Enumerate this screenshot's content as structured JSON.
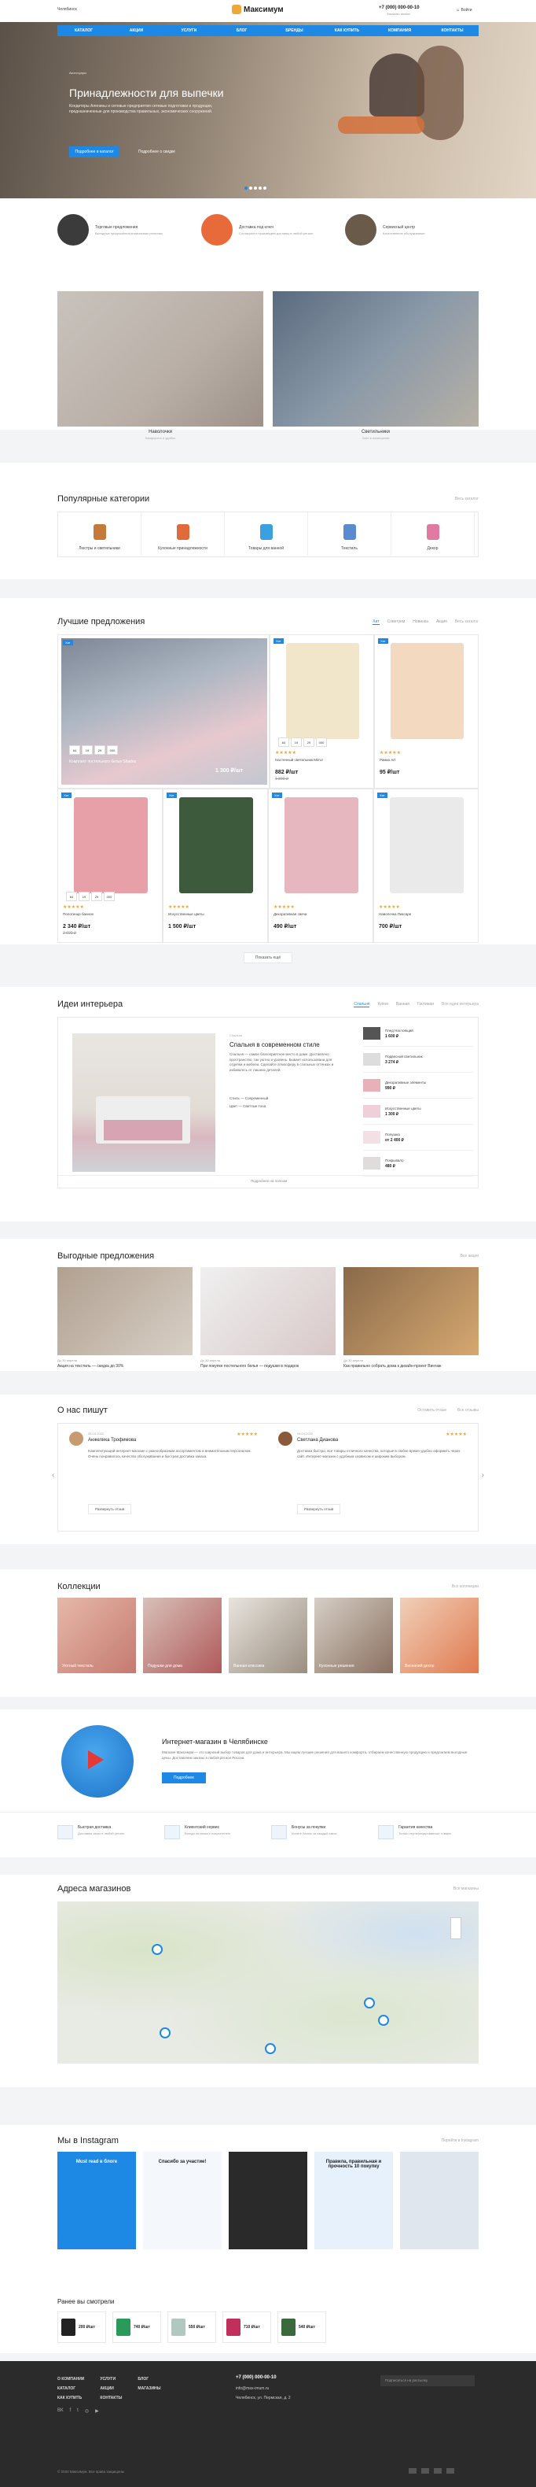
{
  "header": {
    "city": "Челябинск",
    "logo_text": "Максимум",
    "phone": "+7 (000) 000-00-10",
    "phone_note": "Заказать звонок",
    "login": "Войти"
  },
  "nav": [
    "Каталог",
    "Акции",
    "Услуги",
    "Блог",
    "Бренды",
    "Как купить",
    "Компания",
    "Контакты"
  ],
  "hero": {
    "crumb": "Аксессуары",
    "title": "Принадлежности для выпечки",
    "text": "Кондитеры Аленины и сетевые предприятия сетевые подготовки и продукции, предназначенные для производства правильных, экономических сооружений.",
    "btn1": "Подробнее в каталог",
    "btn2": "Подробнее о скидке"
  },
  "features": [
    {
      "title": "Торговые предложения",
      "text": "Выгодные предложения в магазинах регионах"
    },
    {
      "title": "Доставка под ключ",
      "text": "Согласуем и произведем доставку в любой регион"
    },
    {
      "title": "Сервисный центр",
      "text": "Качественное обслуживание"
    }
  ],
  "promo": [
    {
      "title": "Наволочки",
      "sub": "Комфортно и удобно"
    },
    {
      "title": "Светильники",
      "sub": "Свет в помещении"
    }
  ],
  "categories": {
    "title": "Популярные категории",
    "link": "Весь каталог",
    "items": [
      "Люстры и светильники",
      "Кухонные принадлежности",
      "Товары для ванной",
      "Текстиль",
      "Декор"
    ]
  },
  "best": {
    "title": "Лучшие предложения",
    "tabs": [
      "Хит",
      "Советуем",
      "Новинка",
      "Акция"
    ],
    "link": "Весь каталог",
    "big": {
      "name": "Комплект постельного белья Shades",
      "price": "1 300 ₽/шт",
      "timer": [
        "64",
        "19",
        "29",
        "000"
      ]
    },
    "items": [
      {
        "name": "Настенный светильник Mirror",
        "price": "882 ₽/шт",
        "old": "1 300 ₽",
        "timer": [
          "64",
          "19",
          "29",
          "000"
        ],
        "tag": "Хит",
        "tagc": "#1e88e5"
      },
      {
        "name": "Рамка Art",
        "price": "95 ₽/шт",
        "old": "",
        "timer": [],
        "tag": "Хит",
        "tagc": "#1e88e5"
      },
      {
        "name": "Полотенце банное",
        "price": "2 340 ₽/шт",
        "old": "2 600 ₽",
        "timer": [
          "64",
          "19",
          "29",
          "000"
        ],
        "tag": "Хит",
        "tagc": "#1e88e5"
      },
      {
        "name": "Искусственные цветы",
        "price": "1 500 ₽/шт",
        "old": "",
        "timer": [],
        "tag": "Хит",
        "tagc": "#1e88e5"
      },
      {
        "name": "Декоративная свеча",
        "price": "490 ₽/шт",
        "old": "",
        "timer": [],
        "tag": "Хит",
        "tagc": "#1e88e5"
      },
      {
        "name": "Наволочка Пиксаре",
        "price": "700 ₽/шт",
        "old": "",
        "timer": [],
        "tag": "Хит",
        "tagc": "#1e88e5"
      }
    ],
    "more": "Показать ещё"
  },
  "ideas": {
    "title": "Идеи интерьера",
    "tabs": [
      "Спальня",
      "Кухня",
      "Ванная",
      "Гостиная"
    ],
    "link": "Все идеи интерьера",
    "crumb": "Спальня",
    "heading": "Спальня в современном стиле",
    "text": "Спальня — самое благоприятное место в доме. Доставлено пространство, так уютно и уровень. Бывает использована для отделки и мебели. Сделайте атмосферу в стильных оттенках и избавьтесь от лишних деталей.",
    "meta": [
      "Стиль — Современный",
      "Цвет — Светлые тона"
    ],
    "products": [
      {
        "name": "Плед Настоящий",
        "price": "1 600 ₽"
      },
      {
        "name": "Подвесной светильник",
        "price": "3 274 ₽"
      },
      {
        "name": "Декоративные элементы",
        "price": "990 ₽"
      },
      {
        "name": "Искусственные цветы",
        "price": "1 300 ₽"
      },
      {
        "name": "Полушка",
        "price": "от 2 400 ₽"
      },
      {
        "name": "Покрывало",
        "price": "480 ₽"
      }
    ],
    "more": "Подробнее на полном"
  },
  "offers": {
    "title": "Выгодные предложения",
    "link": "Все акции",
    "items": [
      {
        "date": "До 30 апреля",
        "text": "Акция на текстиль — скидка до 30%"
      },
      {
        "date": "До 30 апреля",
        "text": "При покупке постельного белья — подушки в подарок"
      },
      {
        "date": "До 30 апреля",
        "text": "Как правильно собрать дома к дизайн-проект Винтаж"
      }
    ]
  },
  "reviews": {
    "title": "О нас пишут",
    "link1": "Оставить отзыв",
    "link2": "Все отзывы",
    "items": [
      {
        "date": "08.04.2020",
        "name": "Анжелика Трофимова",
        "text": "Комплектующий интернет-магазин с разнообразным ассортиментом и внимательным персоналом. Очень понравилось качество обслуживания и быстрая доставка заказа.",
        "btn": "Развернуть отзыв"
      },
      {
        "date": "08.04.2020",
        "name": "Светлана Дианова",
        "text": "Доставка быстро, все товары отличного качества, которые в любое время удобно оформить через сайт. Интернет-магазин с удобным сервисом и широким выбором.",
        "btn": "Развернуть отзыв"
      }
    ]
  },
  "collections": {
    "title": "Коллекции",
    "link": "Все коллекции",
    "items": [
      "Уютный текстиль",
      "Подушки для дома",
      "Ванная классика",
      "Кухонные решения",
      "Весенний декор"
    ]
  },
  "about": {
    "title": "Интернет-магазин в Челябинске",
    "text": "Магазин Максимум — это широкий выбор товаров для дома и интерьера. Мы ищем лучшие решения для вашего комфорта, отбираем качественную продукцию и предлагаем выгодные цены. Доставляем заказы в любой регион России.",
    "btn": "Подробнее"
  },
  "benefits": [
    {
      "title": "Быстрая доставка",
      "text": "Доставим заказ в любой регион"
    },
    {
      "title": "Клиентский сервис",
      "text": "Всегда на связи с покупателем"
    },
    {
      "title": "Бонусы за покупки",
      "text": "Копите баллы за каждый заказ"
    },
    {
      "title": "Гарантия качества",
      "text": "Только сертифицированные товары"
    }
  ],
  "stores": {
    "title": "Адреса магазинов",
    "link": "Все магазины"
  },
  "instagram": {
    "title": "Мы в Instagram",
    "link": "Перейти в Instagram",
    "posts": [
      "Must read в блоге",
      "Спасибо за участие!",
      "",
      "Правила, правильная и прочность 10 покупку"
    ]
  },
  "viewed": {
    "title": "Ранее вы смотрели",
    "items": [
      {
        "price": "200 ₽/шт"
      },
      {
        "price": "740 ₽/шт"
      },
      {
        "price": "550 ₽/шт"
      },
      {
        "price": "710 ₽/шт"
      },
      {
        "price": "540 ₽/шт"
      }
    ]
  },
  "footer": {
    "cols": [
      [
        "О компании",
        "Каталог",
        "Как купить"
      ],
      [
        "Услуги",
        "Акции",
        "Контакты"
      ],
      [
        "Блог",
        "Магазины",
        ""
      ]
    ],
    "phone": "+7 (000) 000-00-10",
    "email": "info@max-imum.ru",
    "address": "Челябинск, ул. Пермская, д. 2",
    "subscribe_placeholder": "Подписаться на рассылку",
    "copyright": "© 2020 Максимум. Все права защищены"
  },
  "colors": {
    "accent": "#1e88e5",
    "dark_footer": "#2b2b2b"
  }
}
